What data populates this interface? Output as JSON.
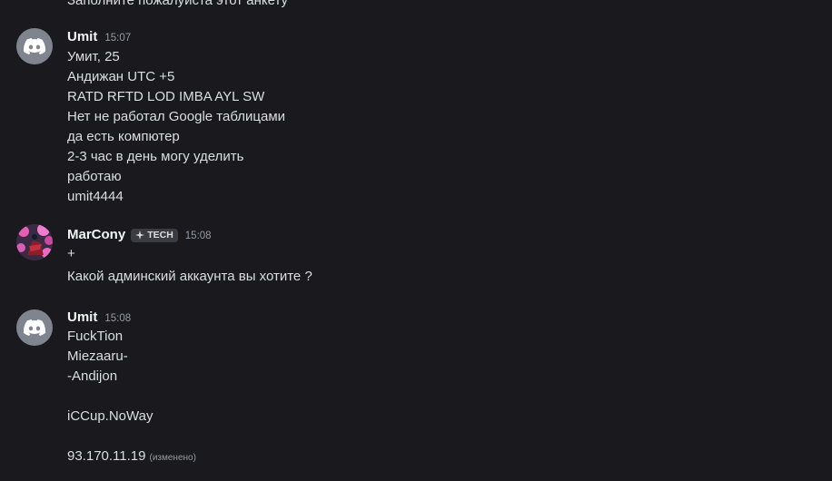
{
  "clipped_top_line": "Заполните пожалуйста этот анкету",
  "messages": [
    {
      "author": "Umit",
      "time": "15:07",
      "avatar_icon": "discord-logo-icon",
      "lines": [
        "Умит, 25",
        "Андижан UTC +5",
        "RATD RFTD LOD IMBA AYL SW",
        "Нет не работал Google таблицами",
        "да есть компютер",
        "2-3 час в день могу уделить",
        "работаю",
        "umit4444"
      ]
    },
    {
      "author": "MarCony",
      "time": "15:08",
      "tag": "TECH",
      "tag_icon": "sparkle-icon",
      "avatar_icon": "profile-picture",
      "lines": [
        "+",
        "Какой админский аккаунта вы хотите ?"
      ]
    },
    {
      "author": "Umit",
      "time": "15:08",
      "avatar_icon": "discord-logo-icon",
      "lines": [
        "FuckTion",
        "Miezaaru-",
        "-Andijon",
        "",
        "iCCup.NoWay",
        "",
        "93.170.11.19"
      ],
      "edited_label": "(изменено)"
    }
  ],
  "colors": {
    "background": "#1a1a1e",
    "text": "#dbdee1",
    "username": "#f2f3f5",
    "timestamp": "#949ba4",
    "discord_avatar": "#80848e"
  }
}
